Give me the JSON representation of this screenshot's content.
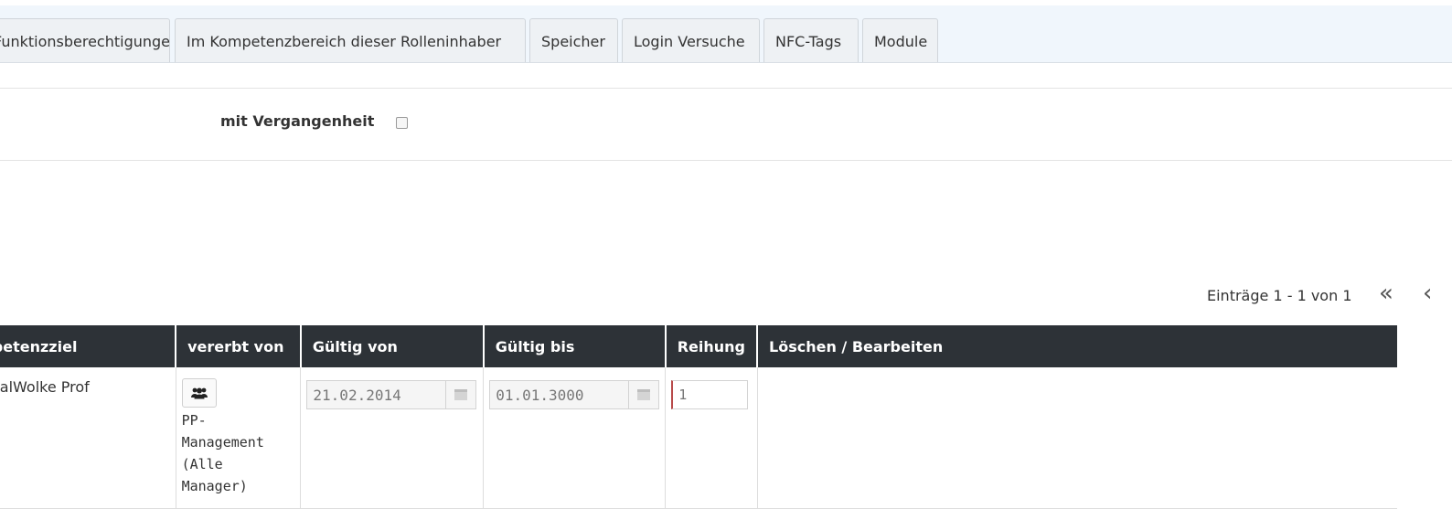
{
  "tabs": [
    "Funktionsberechtigungen",
    "Im Kompetenzbereich dieser Rolleninhaber",
    "Speicher",
    "Login Versuche",
    "NFC-Tags",
    "Module"
  ],
  "filter": {
    "label": "mit Vergangenheit",
    "checked": false
  },
  "pagination": {
    "text": "Einträge 1 - 1 von 1",
    "first_icon": "double-chevron-left",
    "prev_icon": "chevron-left"
  },
  "table": {
    "headers": [
      "Kompetenzziel",
      "vererbt von",
      "Gültig von",
      "Gültig bis",
      "Reihung",
      "Löschen / Bearbeiten"
    ],
    "rows": [
      {
        "ziel": "PersonalWolke Prof",
        "vererbt_icon": "users-icon",
        "vererbt_text": "PP-\nManagement\n(Alle Manager)",
        "gueltig_von": "21.02.2014",
        "gueltig_bis": "01.01.3000",
        "reihung": "1"
      }
    ]
  }
}
